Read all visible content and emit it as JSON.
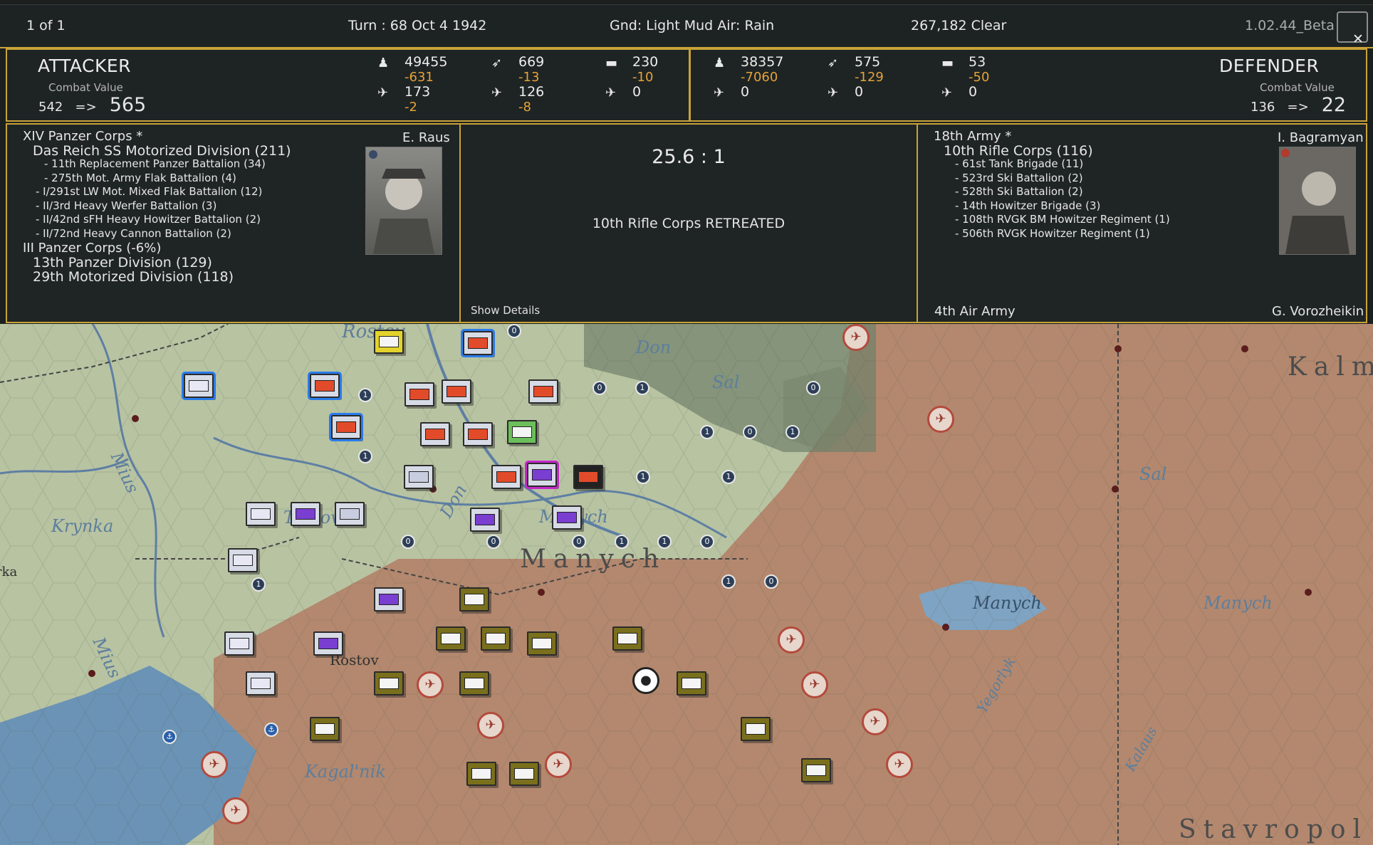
{
  "topbar": {
    "page": "1 of 1",
    "turn": "Turn : 68   Oct 4 1942",
    "weather": "Gnd: Light Mud  Air: Rain",
    "coords": "267,182  Clear",
    "version": "1.02.44_Beta",
    "close_icon": "close-icon"
  },
  "attacker": {
    "title": "ATTACKER",
    "cv_label": "Combat Value",
    "cv_before": "542",
    "arrow": "=>",
    "cv_after": "565",
    "stats": [
      {
        "icon": "infantry-icon",
        "glyph": "♟",
        "value": "49455",
        "delta": "-631"
      },
      {
        "icon": "gun-icon",
        "glyph": "➶",
        "value": "669",
        "delta": "-13"
      },
      {
        "icon": "tank-icon",
        "glyph": "▬",
        "value": "230",
        "delta": "-10"
      },
      {
        "icon": "fighter-icon",
        "glyph": "✈",
        "value": "173",
        "delta": "-2"
      },
      {
        "icon": "bomber-icon",
        "glyph": "✈",
        "value": "126",
        "delta": "-8"
      },
      {
        "icon": "transport-icon",
        "glyph": "✈",
        "value": "0",
        "delta": ""
      }
    ]
  },
  "defender": {
    "title": "DEFENDER",
    "cv_label": "Combat Value",
    "cv_before": "136",
    "arrow": "=>",
    "cv_after": "22",
    "stats": [
      {
        "icon": "infantry-icon",
        "glyph": "♟",
        "value": "38357",
        "delta": "-7060"
      },
      {
        "icon": "gun-icon",
        "glyph": "➶",
        "value": "575",
        "delta": "-129"
      },
      {
        "icon": "tank-icon",
        "glyph": "▬",
        "value": "53",
        "delta": "-50"
      },
      {
        "icon": "fighter-icon",
        "glyph": "✈",
        "value": "0",
        "delta": ""
      },
      {
        "icon": "bomber-icon",
        "glyph": "✈",
        "value": "0",
        "delta": ""
      },
      {
        "icon": "transport-icon",
        "glyph": "✈",
        "value": "0",
        "delta": ""
      }
    ]
  },
  "attacker_oob": {
    "commander": "E. Raus",
    "lines": [
      {
        "text": "XIV Panzer Corps *",
        "level": 1
      },
      {
        "text": "Das Reich SS Motorized Division (211)",
        "level": 2
      },
      {
        "text": "- 11th Replacement Panzer Battalion (34)",
        "level": 3
      },
      {
        "text": "- 275th Mot. Army Flak Battalion (4)",
        "level": 3
      },
      {
        "text": "- I/291st LW Mot. Mixed Flak Battalion (12)",
        "level": 3
      },
      {
        "text": "- II/3rd Heavy Werfer Battalion (3)",
        "level": 3
      },
      {
        "text": "- II/42nd sFH Heavy Howitzer Battalion (2)",
        "level": 3
      },
      {
        "text": "- II/72nd Heavy Cannon Battalion (2)",
        "level": 3
      },
      {
        "text": "III Panzer Corps (-6%)",
        "level": 1
      },
      {
        "text": "13th Panzer Division (129)",
        "level": 2
      },
      {
        "text": "29th Motorized Division (118)",
        "level": 2
      }
    ]
  },
  "result": {
    "ratio": "25.6 : 1",
    "message": "10th Rifle Corps RETREATED",
    "details_label": "Show Details"
  },
  "defender_oob": {
    "commander": "I. Bagramyan",
    "air_army": "4th Air Army",
    "air_commander": "G. Vorozheikin",
    "lines": [
      {
        "text": "18th Army *",
        "level": 1
      },
      {
        "text": "10th Rifle Corps (116)",
        "level": 2
      },
      {
        "text": "- 61st Tank Brigade (11)",
        "level": 3
      },
      {
        "text": "- 523rd Ski Battalion (2)",
        "level": 3
      },
      {
        "text": "- 528th Ski Battalion (2)",
        "level": 3
      },
      {
        "text": "- 14th Howitzer Brigade (3)",
        "level": 3
      },
      {
        "text": "- 108th RVGK BM Howitzer Regiment (1)",
        "level": 3
      },
      {
        "text": "- 506th RVGK Howitzer Regiment (1)",
        "level": 3
      }
    ]
  },
  "map": {
    "labels": {
      "rostov_top": "Rostov",
      "don_1": "Don",
      "sal_1": "Sal",
      "don_2": "Don",
      "mius_1": "Mius",
      "krynka": "Krynka",
      "tuzlov": "Tuzlov",
      "manych_1": "Manych",
      "manych_big": "Manych",
      "manych_2": "Manych",
      "manych_3": "Manych",
      "sal_2": "Sal",
      "mius_2": "Mius",
      "rostov": "Rostov",
      "kagalnik": "Kagal'nik",
      "yegorlyk": "Yegorlyk",
      "kalaus": "Kalaus",
      "kalm": "Kalm",
      "stavropol": "Stavropol",
      "rka": "rka"
    },
    "colors": {
      "land_green": "#b8c3a2",
      "soviet_land": "#b0876d",
      "water": "#6b93b5",
      "accent_border": "#c9a33a",
      "delta_orange": "#e6a23a"
    }
  }
}
